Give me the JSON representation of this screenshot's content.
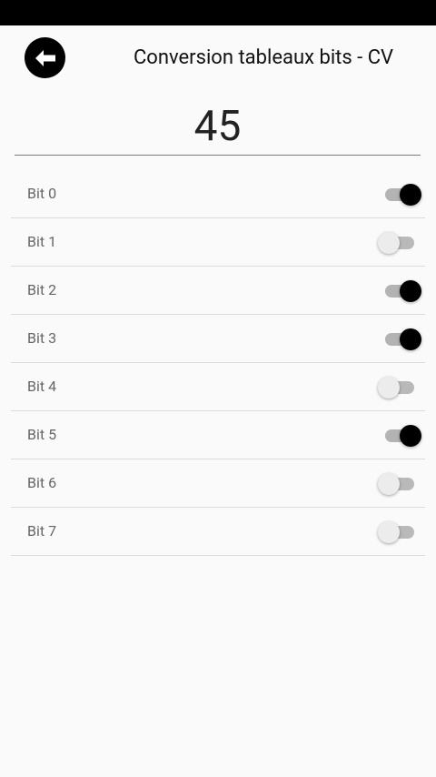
{
  "header": {
    "title": "Conversion tableaux bits - CV",
    "back_icon": "arrow-left-icon"
  },
  "cv_value": "45",
  "bits": [
    {
      "label": "Bit 0",
      "on": true
    },
    {
      "label": "Bit 1",
      "on": false
    },
    {
      "label": "Bit 2",
      "on": true
    },
    {
      "label": "Bit 3",
      "on": true
    },
    {
      "label": "Bit 4",
      "on": false
    },
    {
      "label": "Bit 5",
      "on": true
    },
    {
      "label": "Bit 6",
      "on": false
    },
    {
      "label": "Bit 7",
      "on": false
    }
  ],
  "colors": {
    "status_bar": "#000000",
    "background": "#fafafa",
    "switch_on_thumb": "#000000",
    "switch_off_thumb": "#ececec",
    "switch_track": "#b3b3b3"
  }
}
